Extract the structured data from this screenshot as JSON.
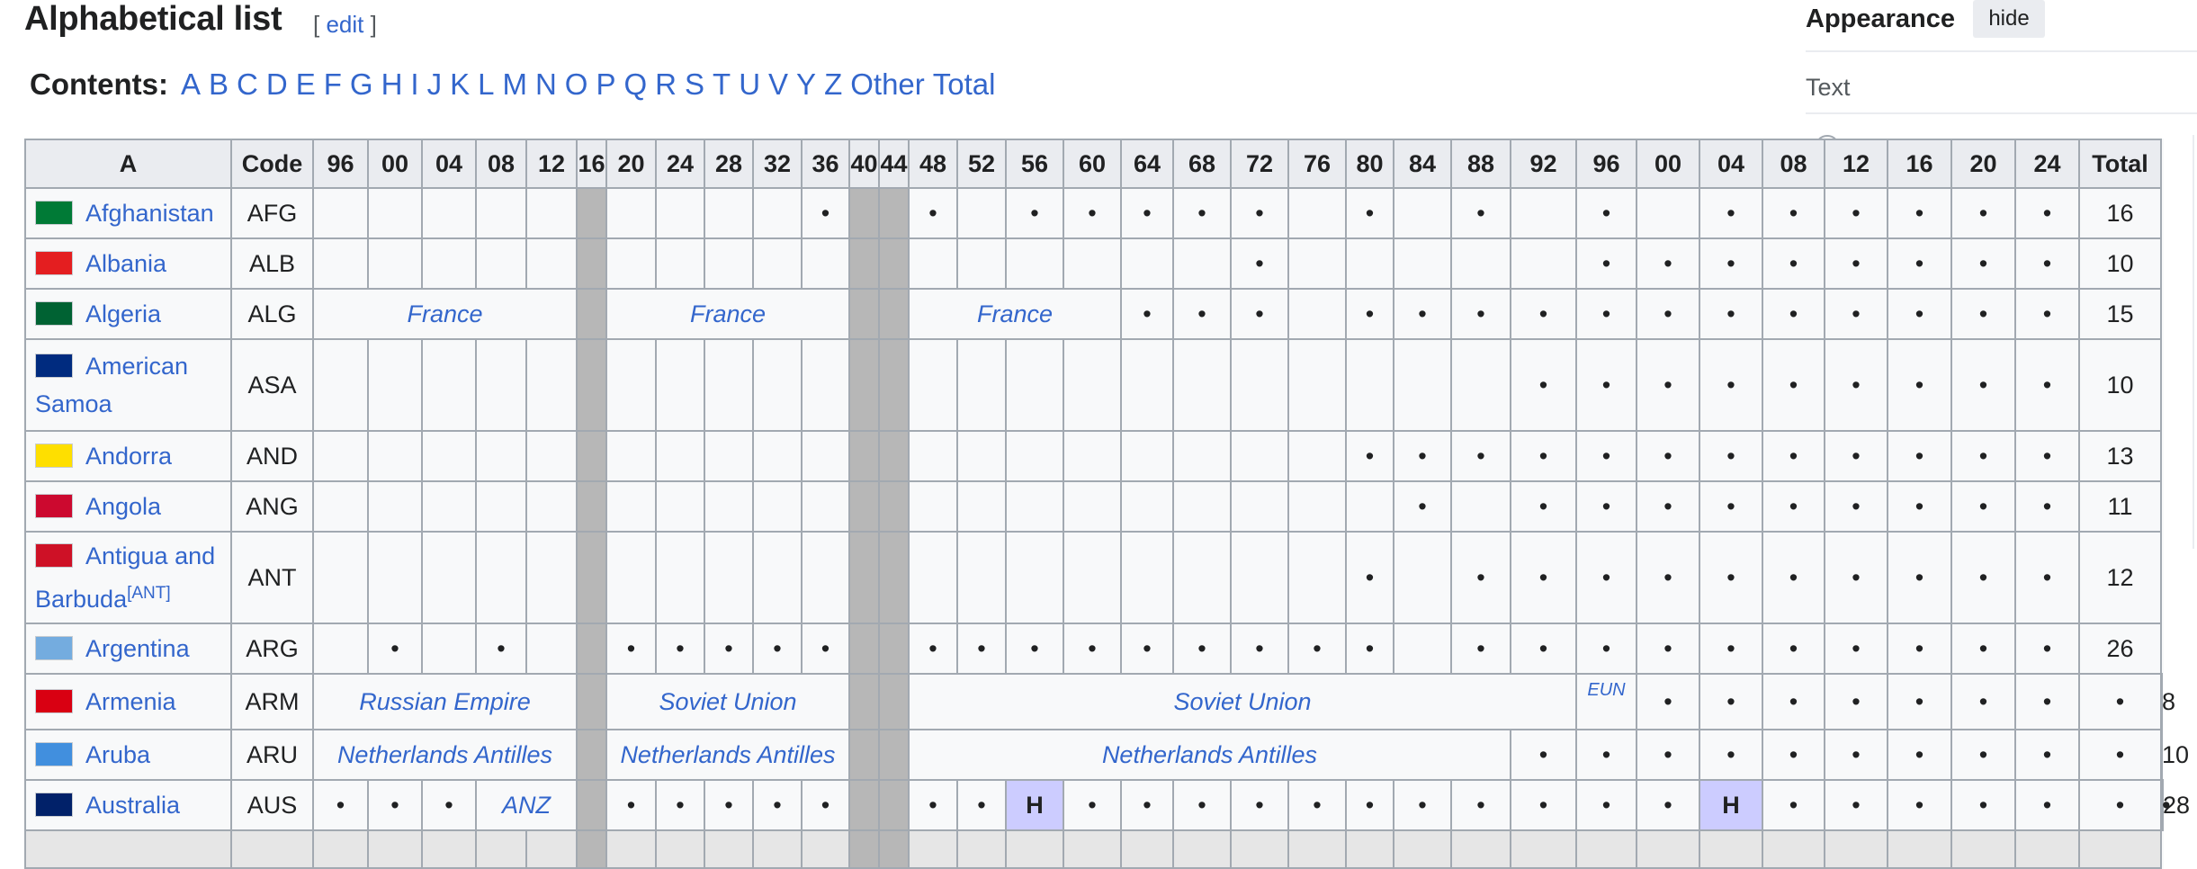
{
  "page": {
    "heading": "Alphabetical list",
    "edit": {
      "open": "[ ",
      "label": "edit",
      "close": " ]"
    },
    "contents_label": "Contents:",
    "contents": [
      "A",
      "B",
      "C",
      "D",
      "E",
      "F",
      "G",
      "H",
      "I",
      "J",
      "K",
      "L",
      "M",
      "N",
      "O",
      "P",
      "Q",
      "R",
      "S",
      "T",
      "U",
      "V",
      "Y",
      "Z",
      "Other",
      "Total"
    ]
  },
  "sidebar": {
    "title": "Appearance",
    "hide_label": "hide",
    "text_label": "Text"
  },
  "table": {
    "headers": [
      "A",
      "Code",
      "96",
      "00",
      "04",
      "08",
      "12",
      "16",
      "20",
      "24",
      "28",
      "32",
      "36",
      "40",
      "44",
      "48",
      "52",
      "56",
      "60",
      "64",
      "68",
      "72",
      "76",
      "80",
      "84",
      "88",
      "92",
      "96",
      "00",
      "04",
      "08",
      "12",
      "16",
      "20",
      "24",
      "Total"
    ],
    "rows": [
      {
        "name": "Afghanistan",
        "code": "AFG",
        "total": "16",
        "flag": "#007a36",
        "cells": [
          "",
          "",
          "",
          "",
          "",
          "G",
          "",
          "",
          "",
          "",
          "•",
          "G",
          "G",
          "•",
          "",
          "•",
          "•",
          "•",
          "•",
          "•",
          "",
          "•",
          "",
          "•",
          "",
          "•",
          "",
          "•",
          "•",
          "•",
          "•",
          "•",
          "•"
        ]
      },
      {
        "name": "Albania",
        "code": "ALB",
        "total": "10",
        "flag": "#e41e20",
        "cells": [
          "",
          "",
          "",
          "",
          "",
          "G",
          "",
          "",
          "",
          "",
          "",
          "G",
          "G",
          "",
          "",
          "",
          "",
          "",
          "",
          "•",
          "",
          "",
          "",
          "",
          "",
          "•",
          "•",
          "•",
          "•",
          "•",
          "•",
          "•",
          "•"
        ]
      },
      {
        "name": "Algeria",
        "code": "ALG",
        "total": "15",
        "flag": "#006233",
        "cells": [
          {
            "t": "France",
            "s": 5
          },
          "G",
          {
            "t": "France",
            "s": 5
          },
          "G",
          "G",
          {
            "t": "France",
            "s": 4
          },
          "•",
          "•",
          "•",
          "",
          "•",
          "•",
          "•",
          "•",
          "•",
          "•",
          "•",
          "•",
          "•",
          "•",
          "•",
          "•"
        ]
      },
      {
        "name": "American Samoa",
        "code": "ASA",
        "total": "10",
        "flag": "#002b7f",
        "tall": true,
        "cells": [
          "",
          "",
          "",
          "",
          "",
          "G",
          "",
          "",
          "",
          "",
          "",
          "G",
          "G",
          "",
          "",
          "",
          "",
          "",
          "",
          "",
          "",
          "",
          "",
          "",
          "•",
          "•",
          "•",
          "•",
          "•",
          "•",
          "•",
          "•",
          "•"
        ]
      },
      {
        "name": "Andorra",
        "code": "AND",
        "total": "13",
        "flag": "#fedf00",
        "cells": [
          "",
          "",
          "",
          "",
          "",
          "G",
          "",
          "",
          "",
          "",
          "",
          "G",
          "G",
          "",
          "",
          "",
          "",
          "",
          "",
          "",
          "",
          "•",
          "•",
          "•",
          "•",
          "•",
          "•",
          "•",
          "•",
          "•",
          "•",
          "•",
          "•"
        ]
      },
      {
        "name": "Angola",
        "code": "ANG",
        "total": "11",
        "flag": "#cc092f",
        "cells": [
          "",
          "",
          "",
          "",
          "",
          "G",
          "",
          "",
          "",
          "",
          "",
          "G",
          "G",
          "",
          "",
          "",
          "",
          "",
          "",
          "",
          "",
          "",
          "•",
          "",
          "•",
          "•",
          "•",
          "•",
          "•",
          "•",
          "•",
          "•",
          "•"
        ]
      },
      {
        "name": "Antigua and Barbuda",
        "sup": "[ANT]",
        "code": "ANT",
        "total": "12",
        "flag": "#ce1126",
        "tall": true,
        "cells": [
          "",
          "",
          "",
          "",
          "",
          "G",
          "",
          "",
          "",
          "",
          "",
          "G",
          "G",
          "",
          "",
          "",
          "",
          "",
          "",
          "",
          "",
          "•",
          "",
          "•",
          "•",
          "•",
          "•",
          "•",
          "•",
          "•",
          "•",
          "•",
          "•"
        ]
      },
      {
        "name": "Argentina",
        "code": "ARG",
        "total": "26",
        "flag": "#74acdf",
        "cells": [
          "",
          "•",
          "",
          "•",
          "",
          "G",
          "•",
          "•",
          "•",
          "•",
          "•",
          "G",
          "G",
          "•",
          "•",
          "•",
          "•",
          "•",
          "•",
          "•",
          "•",
          "•",
          "",
          "•",
          "•",
          "•",
          "•",
          "•",
          "•",
          "•",
          "•",
          "•",
          "•"
        ]
      },
      {
        "name": "Armenia",
        "code": "ARM",
        "total": "8",
        "flag": "#d90012",
        "cells": [
          {
            "t": "Russian Empire",
            "s": 5
          },
          "G",
          {
            "t": "Soviet Union",
            "s": 5
          },
          "G",
          "G",
          {
            "t": "Soviet Union",
            "s": 12
          },
          {
            "t": "EUN",
            "eun": true
          },
          "•",
          "•",
          "•",
          "•",
          "•",
          "•",
          "•",
          "•"
        ]
      },
      {
        "name": "Aruba",
        "code": "ARU",
        "total": "10",
        "flag": "#418fde",
        "cells": [
          {
            "t": "Netherlands Antilles",
            "s": 5
          },
          "G",
          {
            "t": "Netherlands Antilles",
            "s": 5
          },
          "G",
          "G",
          {
            "t": "Netherlands Antilles",
            "s": 11
          },
          "•",
          "•",
          "•",
          "•",
          "•",
          "•",
          "•",
          "•",
          "•",
          "•"
        ]
      },
      {
        "name": "Australia",
        "code": "AUS",
        "total": "28",
        "flag": "#012169",
        "cells": [
          "•",
          "•",
          "•",
          {
            "t": "ANZ",
            "s": 2
          },
          "G",
          "•",
          "•",
          "•",
          "•",
          "•",
          "G",
          "G",
          "•",
          "•",
          {
            "t": "H",
            "host": true
          },
          "•",
          "•",
          "•",
          "•",
          "•",
          "•",
          "•",
          "•",
          "•",
          "•",
          "•",
          {
            "t": "H",
            "host": true
          },
          "•",
          "•",
          "•",
          "•",
          "•",
          "•",
          "•"
        ]
      }
    ]
  }
}
